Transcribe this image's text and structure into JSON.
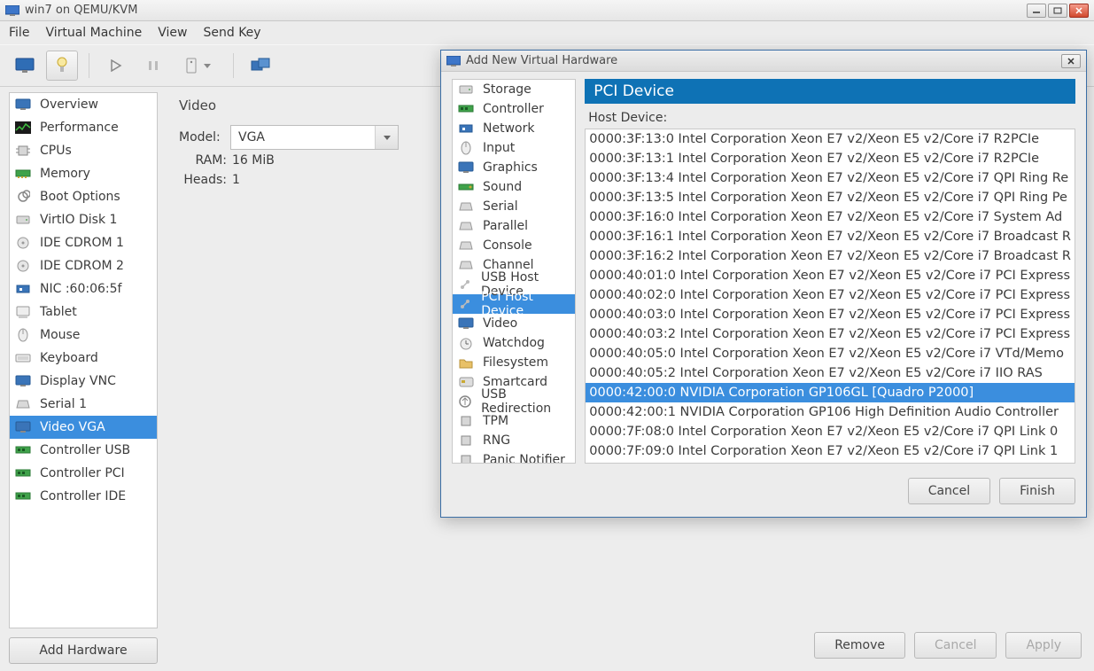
{
  "window": {
    "title": "win7 on QEMU/KVM"
  },
  "menu": [
    "File",
    "Virtual Machine",
    "View",
    "Send Key"
  ],
  "sidebar": {
    "items": [
      {
        "label": "Overview",
        "icon": "monitor"
      },
      {
        "label": "Performance",
        "icon": "perf"
      },
      {
        "label": "CPUs",
        "icon": "cpu"
      },
      {
        "label": "Memory",
        "icon": "memory"
      },
      {
        "label": "Boot Options",
        "icon": "boot"
      },
      {
        "label": "VirtIO Disk 1",
        "icon": "disk"
      },
      {
        "label": "IDE CDROM 1",
        "icon": "cdrom"
      },
      {
        "label": "IDE CDROM 2",
        "icon": "cdrom"
      },
      {
        "label": "NIC :60:06:5f",
        "icon": "nic"
      },
      {
        "label": "Tablet",
        "icon": "tablet"
      },
      {
        "label": "Mouse",
        "icon": "mouse"
      },
      {
        "label": "Keyboard",
        "icon": "keyboard"
      },
      {
        "label": "Display VNC",
        "icon": "display"
      },
      {
        "label": "Serial 1",
        "icon": "serial"
      },
      {
        "label": "Video VGA",
        "icon": "video",
        "selected": true
      },
      {
        "label": "Controller USB",
        "icon": "controller"
      },
      {
        "label": "Controller PCI",
        "icon": "controller"
      },
      {
        "label": "Controller IDE",
        "icon": "controller"
      }
    ],
    "add_hardware": "Add Hardware"
  },
  "detail": {
    "title": "Video",
    "model_label": "Model:",
    "model_value": "VGA",
    "ram_label": "RAM:",
    "ram_value": "16 MiB",
    "heads_label": "Heads:",
    "heads_value": "1"
  },
  "main_buttons": {
    "remove": "Remove",
    "cancel": "Cancel",
    "apply": "Apply"
  },
  "dialog": {
    "title": "Add New Virtual Hardware",
    "types": [
      {
        "label": "Storage",
        "icon": "disk"
      },
      {
        "label": "Controller",
        "icon": "controller"
      },
      {
        "label": "Network",
        "icon": "nic"
      },
      {
        "label": "Input",
        "icon": "mouse"
      },
      {
        "label": "Graphics",
        "icon": "display"
      },
      {
        "label": "Sound",
        "icon": "sound"
      },
      {
        "label": "Serial",
        "icon": "serial"
      },
      {
        "label": "Parallel",
        "icon": "serial"
      },
      {
        "label": "Console",
        "icon": "serial"
      },
      {
        "label": "Channel",
        "icon": "serial"
      },
      {
        "label": "USB Host Device",
        "icon": "usb"
      },
      {
        "label": "PCI Host Device",
        "icon": "usb",
        "selected": true
      },
      {
        "label": "Video",
        "icon": "video"
      },
      {
        "label": "Watchdog",
        "icon": "watchdog"
      },
      {
        "label": "Filesystem",
        "icon": "folder"
      },
      {
        "label": "Smartcard",
        "icon": "smartcard"
      },
      {
        "label": "USB Redirection",
        "icon": "usbredir"
      },
      {
        "label": "TPM",
        "icon": "tpm"
      },
      {
        "label": "RNG",
        "icon": "rng"
      },
      {
        "label": "Panic Notifier",
        "icon": "panic"
      }
    ],
    "panel_title": "PCI Device",
    "host_device_label": "Host Device:",
    "devices": [
      "0000:3F:13:0 Intel Corporation Xeon E7 v2/Xeon E5 v2/Core i7 R2PCIe",
      "0000:3F:13:1 Intel Corporation Xeon E7 v2/Xeon E5 v2/Core i7 R2PCIe",
      "0000:3F:13:4 Intel Corporation Xeon E7 v2/Xeon E5 v2/Core i7 QPI Ring Re",
      "0000:3F:13:5 Intel Corporation Xeon E7 v2/Xeon E5 v2/Core i7 QPI Ring Pe",
      "0000:3F:16:0 Intel Corporation Xeon E7 v2/Xeon E5 v2/Core i7 System Ad",
      "0000:3F:16:1 Intel Corporation Xeon E7 v2/Xeon E5 v2/Core i7 Broadcast R",
      "0000:3F:16:2 Intel Corporation Xeon E7 v2/Xeon E5 v2/Core i7 Broadcast R",
      "0000:40:01:0 Intel Corporation Xeon E7 v2/Xeon E5 v2/Core i7 PCI Express",
      "0000:40:02:0 Intel Corporation Xeon E7 v2/Xeon E5 v2/Core i7 PCI Express",
      "0000:40:03:0 Intel Corporation Xeon E7 v2/Xeon E5 v2/Core i7 PCI Express",
      "0000:40:03:2 Intel Corporation Xeon E7 v2/Xeon E5 v2/Core i7 PCI Express",
      "0000:40:05:0 Intel Corporation Xeon E7 v2/Xeon E5 v2/Core i7 VTd/Memo",
      "0000:40:05:2 Intel Corporation Xeon E7 v2/Xeon E5 v2/Core i7 IIO RAS",
      "0000:42:00:0 NVIDIA Corporation GP106GL [Quadro P2000]",
      "0000:42:00:1 NVIDIA Corporation GP106 High Definition Audio Controller",
      "0000:7F:08:0 Intel Corporation Xeon E7 v2/Xeon E5 v2/Core i7 QPI Link 0",
      "0000:7F:09:0 Intel Corporation Xeon E7 v2/Xeon E5 v2/Core i7 QPI Link 1"
    ],
    "selected_device_index": 13,
    "cancel": "Cancel",
    "finish": "Finish"
  }
}
